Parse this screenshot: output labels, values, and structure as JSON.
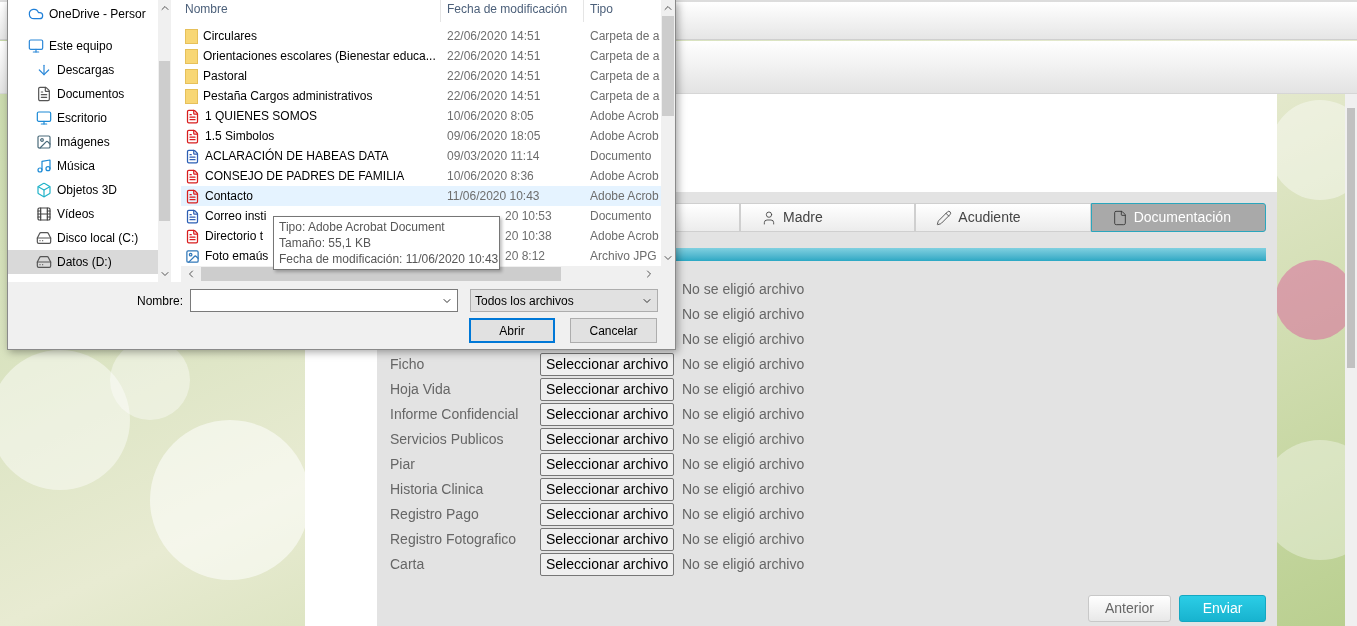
{
  "dialog": {
    "nav": [
      {
        "label": "OneDrive - Persor",
        "selected": false
      },
      {
        "label": "Este equipo",
        "selected": false,
        "children": [
          {
            "label": "Descargas",
            "selected": false
          },
          {
            "label": "Documentos",
            "selected": false
          },
          {
            "label": "Escritorio",
            "selected": false
          },
          {
            "label": "Imágenes",
            "selected": false
          },
          {
            "label": "Música",
            "selected": false
          },
          {
            "label": "Objetos 3D",
            "selected": false
          },
          {
            "label": "Vídeos",
            "selected": false
          },
          {
            "label": "Disco local (C:)",
            "selected": false
          },
          {
            "label": "Datos (D:)",
            "selected": true
          }
        ]
      }
    ],
    "columns": [
      "Nombre",
      "Fecha de modificación",
      "Tipo"
    ],
    "files": [
      {
        "kind": "folder",
        "name": "Circulares",
        "date": "22/06/2020 14:51",
        "type": "Carpeta de a",
        "hovered": false
      },
      {
        "kind": "folder",
        "name": "Orientaciones escolares (Bienestar educa...",
        "date": "22/06/2020 14:51",
        "type": "Carpeta de a",
        "hovered": false
      },
      {
        "kind": "folder",
        "name": "Pastoral",
        "date": "22/06/2020 14:51",
        "type": "Carpeta de a",
        "hovered": false
      },
      {
        "kind": "folder",
        "name": "Pestaña Cargos administrativos",
        "date": "22/06/2020 14:51",
        "type": "Carpeta de a",
        "hovered": false
      },
      {
        "kind": "pdf",
        "name": "1 QUIENES SOMOS",
        "date": "10/06/2020 8:05",
        "type": "Adobe Acrob",
        "hovered": false
      },
      {
        "kind": "pdf",
        "name": "1.5 Simbolos",
        "date": "09/06/2020 18:05",
        "type": "Adobe Acrob",
        "hovered": false
      },
      {
        "kind": "word",
        "name": "ACLARACIÓN DE HABEAS DATA",
        "date": "09/03/2020 11:14",
        "type": "Documento",
        "hovered": false
      },
      {
        "kind": "pdf",
        "name": "CONSEJO DE PADRES DE FAMILIA",
        "date": "10/06/2020 8:36",
        "type": "Adobe Acrob",
        "hovered": false
      },
      {
        "kind": "pdf",
        "name": "Contacto",
        "date": "11/06/2020 10:43",
        "type": "Adobe Acrob",
        "hovered": true
      },
      {
        "kind": "word",
        "name": "Correo insti",
        "date": "20 10:53",
        "type": "Documento",
        "hovered": false
      },
      {
        "kind": "pdf",
        "name": "Directorio t",
        "date": "20 10:38",
        "type": "Adobe Acrob",
        "hovered": false
      },
      {
        "kind": "image",
        "name": "Foto emaús",
        "date": "20 8:12",
        "type": "Archivo JPG",
        "hovered": false
      }
    ],
    "tooltip": [
      "Tipo: Adobe Acrobat Document",
      "Tamaño: 55,1 KB",
      "Fecha de modificación: 11/06/2020 10:43"
    ],
    "name_label": "Nombre:",
    "filter": "Todos los archivos",
    "open_button": "Abrir",
    "cancel_button": "Cancelar"
  },
  "steps": [
    {
      "selected": false
    },
    {
      "label": "Madre",
      "selected": false
    },
    {
      "label": "Acudiente",
      "selected": false
    },
    {
      "label": "Documentación",
      "selected": true
    }
  ],
  "progress": {
    "level": 1
  },
  "uploads": [
    {
      "status": "No se eligió archivo"
    },
    {
      "status": "No se eligió archivo"
    },
    {
      "status": "No se eligió archivo"
    },
    {
      "label": "Ficho",
      "button": "Seleccionar archivo",
      "status": "No se eligió archivo"
    },
    {
      "label": "Hoja Vida",
      "button": "Seleccionar archivo",
      "status": "No se eligió archivo"
    },
    {
      "label": "Informe Confidencial",
      "button": "Seleccionar archivo",
      "status": "No se eligió archivo"
    },
    {
      "label": "Servicios Publicos",
      "button": "Seleccionar archivo",
      "status": "No se eligió archivo"
    },
    {
      "label": "Piar",
      "button": "Seleccionar archivo",
      "status": "No se eligió archivo"
    },
    {
      "label": "Historia Clinica",
      "button": "Seleccionar archivo",
      "status": "No se eligió archivo"
    },
    {
      "label": "Registro Pago",
      "button": "Seleccionar archivo",
      "status": "No se eligió archivo"
    },
    {
      "label": "Registro Fotografico",
      "button": "Seleccionar archivo",
      "status": "No se eligió archivo"
    },
    {
      "label": "Carta",
      "button": "Seleccionar archivo",
      "status": "No se eligió archivo"
    }
  ],
  "back_button": "Anterior",
  "submit_button": "Enviar"
}
